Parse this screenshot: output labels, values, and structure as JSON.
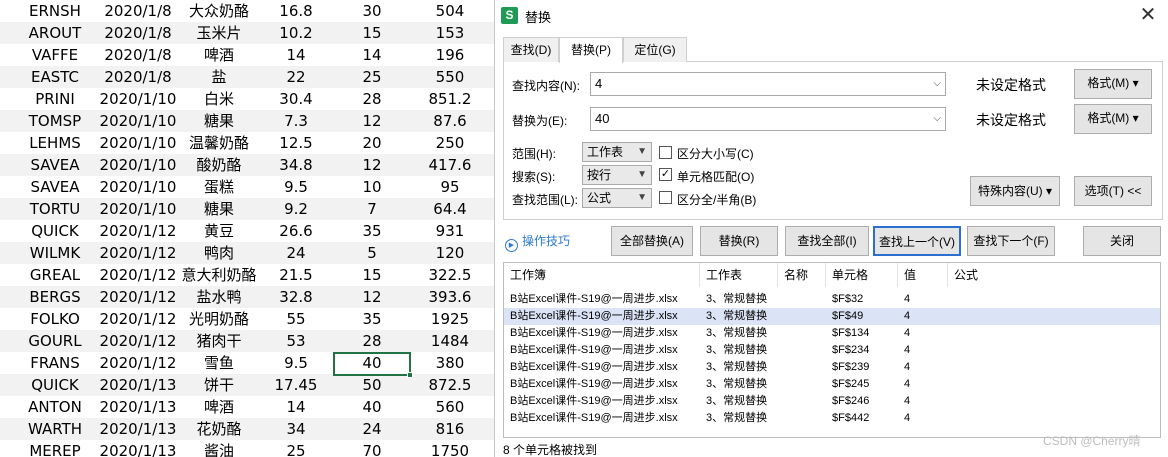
{
  "sheet": {
    "rows": [
      [
        "ERNSH",
        "2020/1/8",
        "大众奶酪",
        "16.8",
        "30",
        "504"
      ],
      [
        "AROUT",
        "2020/1/8",
        "玉米片",
        "10.2",
        "15",
        "153"
      ],
      [
        "VAFFE",
        "2020/1/8",
        "啤酒",
        "14",
        "14",
        "196"
      ],
      [
        "EASTC",
        "2020/1/8",
        "盐",
        "22",
        "25",
        "550"
      ],
      [
        "PRINI",
        "2020/1/10",
        "白米",
        "30.4",
        "28",
        "851.2"
      ],
      [
        "TOMSP",
        "2020/1/10",
        "糖果",
        "7.3",
        "12",
        "87.6"
      ],
      [
        "LEHMS",
        "2020/1/10",
        "温馨奶酪",
        "12.5",
        "20",
        "250"
      ],
      [
        "SAVEA",
        "2020/1/10",
        "酸奶酪",
        "34.8",
        "12",
        "417.6"
      ],
      [
        "SAVEA",
        "2020/1/10",
        "蛋糕",
        "9.5",
        "10",
        "95"
      ],
      [
        "TORTU",
        "2020/1/10",
        "糖果",
        "9.2",
        "7",
        "64.4"
      ],
      [
        "QUICK",
        "2020/1/12",
        "黄豆",
        "26.6",
        "35",
        "931"
      ],
      [
        "WILMK",
        "2020/1/12",
        "鸭肉",
        "24",
        "5",
        "120"
      ],
      [
        "GREAL",
        "2020/1/12",
        "意大利奶酪",
        "21.5",
        "15",
        "322.5"
      ],
      [
        "BERGS",
        "2020/1/12",
        "盐水鸭",
        "32.8",
        "12",
        "393.6"
      ],
      [
        "FOLKO",
        "2020/1/12",
        "光明奶酪",
        "55",
        "35",
        "1925"
      ],
      [
        "GOURL",
        "2020/1/12",
        "猪肉干",
        "53",
        "28",
        "1484"
      ],
      [
        "FRANS",
        "2020/1/12",
        "雪鱼",
        "9.5",
        "40",
        "380"
      ],
      [
        "QUICK",
        "2020/1/13",
        "饼干",
        "17.45",
        "50",
        "872.5"
      ],
      [
        "ANTON",
        "2020/1/13",
        "啤酒",
        "14",
        "40",
        "560"
      ],
      [
        "WARTH",
        "2020/1/13",
        "花奶酪",
        "34",
        "24",
        "816"
      ],
      [
        "MEREP",
        "2020/1/13",
        "酱油",
        "25",
        "70",
        "1750"
      ]
    ]
  },
  "dialog": {
    "icon_letter": "S",
    "title": "替换",
    "close": "✕",
    "tabs": [
      "查找(D)",
      "替换(P)",
      "定位(G)"
    ],
    "find_label": "查找内容(N):",
    "find_value": "4",
    "replace_label": "替换为(E):",
    "replace_value": "40",
    "no_format_1": "未设定格式",
    "no_format_2": "未设定格式",
    "format_btn_1": "格式(M)",
    "format_btn_2": "格式(M)",
    "scope_label": "范围(H):",
    "scope_value": "工作表",
    "search_label": "搜索(S):",
    "search_value": "按行",
    "lookin_label": "查找范围(L):",
    "lookin_value": "公式",
    "match_case": "区分大小写(C)",
    "match_cell": "单元格匹配(O)",
    "match_width": "区分全/半角(B)",
    "match_cell_checked": true,
    "special_btn": "特殊内容(U)",
    "options_btn": "选项(T) <<",
    "tips": "操作技巧",
    "buttons": [
      "全部替换(A)",
      "替换(R)",
      "查找全部(I)",
      "查找上一个(V)",
      "查找下一个(F)",
      "关闭"
    ],
    "results_headers": [
      "工作簿",
      "工作表",
      "名称",
      "单元格",
      "值",
      "公式"
    ],
    "results": [
      [
        "B站Excel课件-S19@一周进步.xlsx",
        "3、常规替换",
        "",
        "$F$32",
        "4",
        ""
      ],
      [
        "B站Excel课件-S19@一周进步.xlsx",
        "3、常规替换",
        "",
        "$F$49",
        "4",
        ""
      ],
      [
        "B站Excel课件-S19@一周进步.xlsx",
        "3、常规替换",
        "",
        "$F$134",
        "4",
        ""
      ],
      [
        "B站Excel课件-S19@一周进步.xlsx",
        "3、常规替换",
        "",
        "$F$234",
        "4",
        ""
      ],
      [
        "B站Excel课件-S19@一周进步.xlsx",
        "3、常规替换",
        "",
        "$F$239",
        "4",
        ""
      ],
      [
        "B站Excel课件-S19@一周进步.xlsx",
        "3、常规替换",
        "",
        "$F$245",
        "4",
        ""
      ],
      [
        "B站Excel课件-S19@一周进步.xlsx",
        "3、常规替换",
        "",
        "$F$246",
        "4",
        ""
      ],
      [
        "B站Excel课件-S19@一周进步.xlsx",
        "3、常规替换",
        "",
        "$F$442",
        "4",
        ""
      ]
    ],
    "found_text": "8 个单元格被找到"
  },
  "watermark": "CSDN @Cherry晴",
  "colors": {
    "selection": "#217346",
    "link": "#2d7acd",
    "result_selected": "#dbe4f6",
    "focus_border": "#2c6fd1"
  }
}
